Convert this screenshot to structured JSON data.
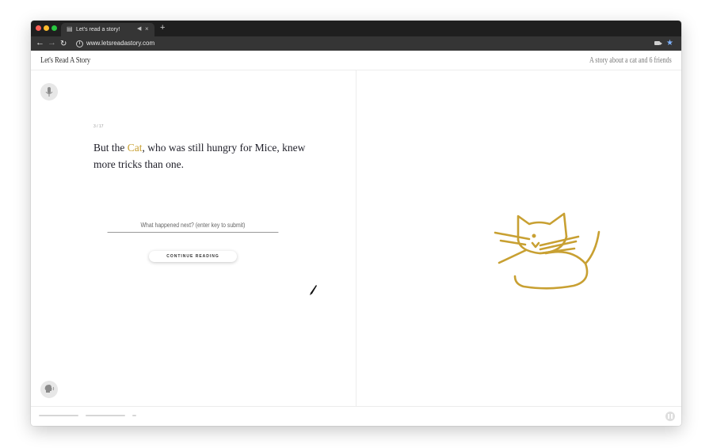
{
  "browser": {
    "tab_title": "Let's read a story!",
    "tab_favicon": "book-icon",
    "new_tab_label": "+",
    "url": "www.letsreadastory.com"
  },
  "header": {
    "brand": "Let's Read A Story",
    "tagline": "A story about a cat and 6 friends"
  },
  "story": {
    "page_counter": "3 / 17",
    "text_before": "But the ",
    "highlight": "Cat",
    "text_after": ", who was still hungry for Mice, knew more tricks than one.",
    "highlight_color": "#c8a032",
    "answer_placeholder": "What happened next? (enter key to submit)",
    "continue_label": "CONTINUE READING"
  },
  "footer": {
    "progress_segments": 3
  },
  "icons": {
    "mic": "microphone-icon",
    "speech": "speaking-head-icon",
    "pause": "pause-icon",
    "drawing": "cat-drawing"
  }
}
